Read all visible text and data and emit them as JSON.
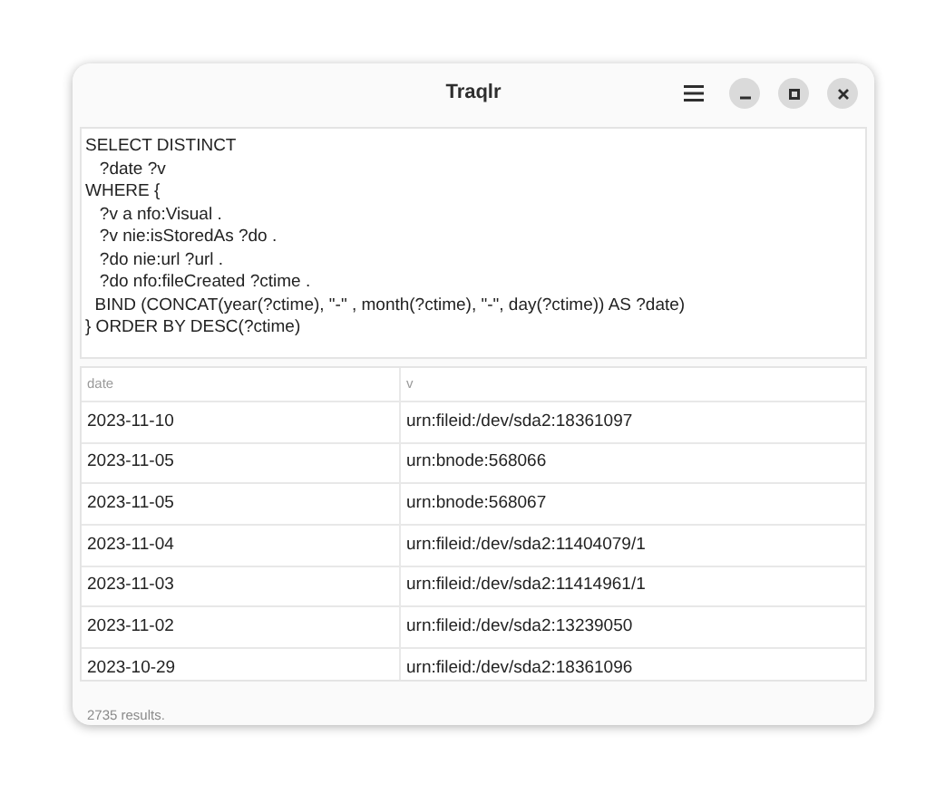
{
  "window": {
    "title": "Traqlr"
  },
  "query": {
    "lines": [
      "SELECT DISTINCT",
      "   ?date ?v",
      "WHERE {",
      "   ?v a nfo:Visual .",
      "   ?v nie:isStoredAs ?do .",
      "   ?do nie:url ?url .",
      "   ?do nfo:fileCreated ?ctime .",
      "  BIND (CONCAT(year(?ctime), \"-\" , month(?ctime), \"-\", day(?ctime)) AS ?date)",
      "} ORDER BY DESC(?ctime)"
    ]
  },
  "table": {
    "columns": [
      "date",
      "v"
    ],
    "rows": [
      [
        "2023-11-10",
        "urn:fileid:/dev/sda2:18361097"
      ],
      [
        "2023-11-05",
        "urn:bnode:568066"
      ],
      [
        "2023-11-05",
        "urn:bnode:568067"
      ],
      [
        "2023-11-04",
        "urn:fileid:/dev/sda2:11404079/1"
      ],
      [
        "2023-11-03",
        "urn:fileid:/dev/sda2:11414961/1"
      ],
      [
        "2023-11-02",
        "urn:fileid:/dev/sda2:13239050"
      ],
      [
        "2023-10-29",
        "urn:fileid:/dev/sda2:18361096"
      ]
    ]
  },
  "status_bar": "2735 results."
}
